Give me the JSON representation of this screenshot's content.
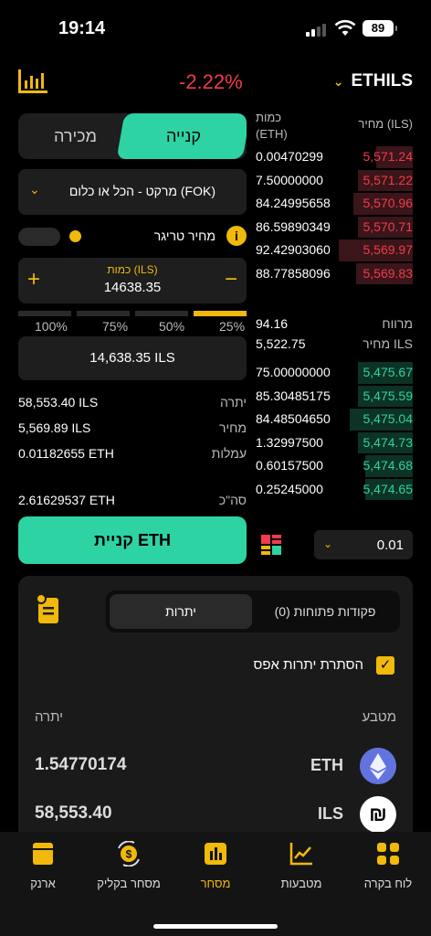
{
  "status": {
    "time": "19:14",
    "battery": "89"
  },
  "header": {
    "change": "-2.22%",
    "pair": "ETHILS"
  },
  "form": {
    "tab_buy": "קנייה",
    "tab_sell": "מכירה",
    "order_type": "מרקט - הכל או כלום (FOK)",
    "trigger_label": "מחיר טריגר",
    "qty_label": "כמות (ILS)",
    "qty_value": "14638.35",
    "plus": "+",
    "minus": "−",
    "pct_labels": [
      "100%",
      "75%",
      "50%",
      "25%"
    ],
    "pct_selected": 0.25,
    "total_value": "14,638.35 ILS",
    "rows": [
      {
        "label": "יתרה",
        "value": "58,553.40 ILS"
      },
      {
        "label": "מחיר",
        "value": "5,569.89 ILS"
      },
      {
        "label": "עמלות",
        "value": "0.01182655 ETH"
      }
    ],
    "sum_label": "סה\"כ",
    "sum_value": "2.61629537 ETH",
    "buy_button": "קניית ETH"
  },
  "orderbook": {
    "col_qty": "כמות",
    "col_qty_unit": "(ETH)",
    "col_price": "מחיר (ILS)",
    "asks": [
      {
        "qty": "0.00470299",
        "price": "5,571.24",
        "depth": 0.23
      },
      {
        "qty": "7.50000000",
        "price": "5,571.22",
        "depth": 0.35
      },
      {
        "qty": "84.24995658",
        "price": "5,570.96",
        "depth": 0.38
      },
      {
        "qty": "86.59890349",
        "price": "5,570.71",
        "depth": 0.35
      },
      {
        "qty": "92.42903060",
        "price": "5,569.97",
        "depth": 0.47
      },
      {
        "qty": "88.77858096",
        "price": "5,569.83",
        "depth": 0.36
      }
    ],
    "spread_label": "מרווח",
    "spread_value": "94.16",
    "mid_label": "מחיר ILS",
    "mid_value": "5,522.75",
    "bids": [
      {
        "qty": "75.00000000",
        "price": "5,475.67",
        "depth": 0.35
      },
      {
        "qty": "85.30485175",
        "price": "5,475.59",
        "depth": 0.35
      },
      {
        "qty": "84.48504650",
        "price": "5,475.04",
        "depth": 0.4
      },
      {
        "qty": "1.32997500",
        "price": "5,474.73",
        "depth": 0.35
      },
      {
        "qty": "0.60157500",
        "price": "5,474.68",
        "depth": 0.3
      },
      {
        "qty": "0.25245000",
        "price": "5,474.65",
        "depth": 0.3
      }
    ],
    "depth_step": "0.01"
  },
  "card": {
    "tab_balances": "יתרות",
    "tab_open_orders": "פקודות פתוחות (0)",
    "hide_zero": "הסתרת יתרות אפס",
    "col_balance": "יתרה",
    "col_currency": "מטבע",
    "assets": [
      {
        "symbol": "ETH",
        "balance": "1.54770174"
      },
      {
        "symbol": "ILS",
        "balance": "58,553.40"
      }
    ]
  },
  "nav": {
    "items": [
      "ארנק",
      "מסחר בקליק",
      "מסחר",
      "מטבעות",
      "לוח בקרה"
    ]
  },
  "colors": {
    "accent": "#f0b90b",
    "buy": "#2ed3a4",
    "sell": "#f23b4c"
  }
}
